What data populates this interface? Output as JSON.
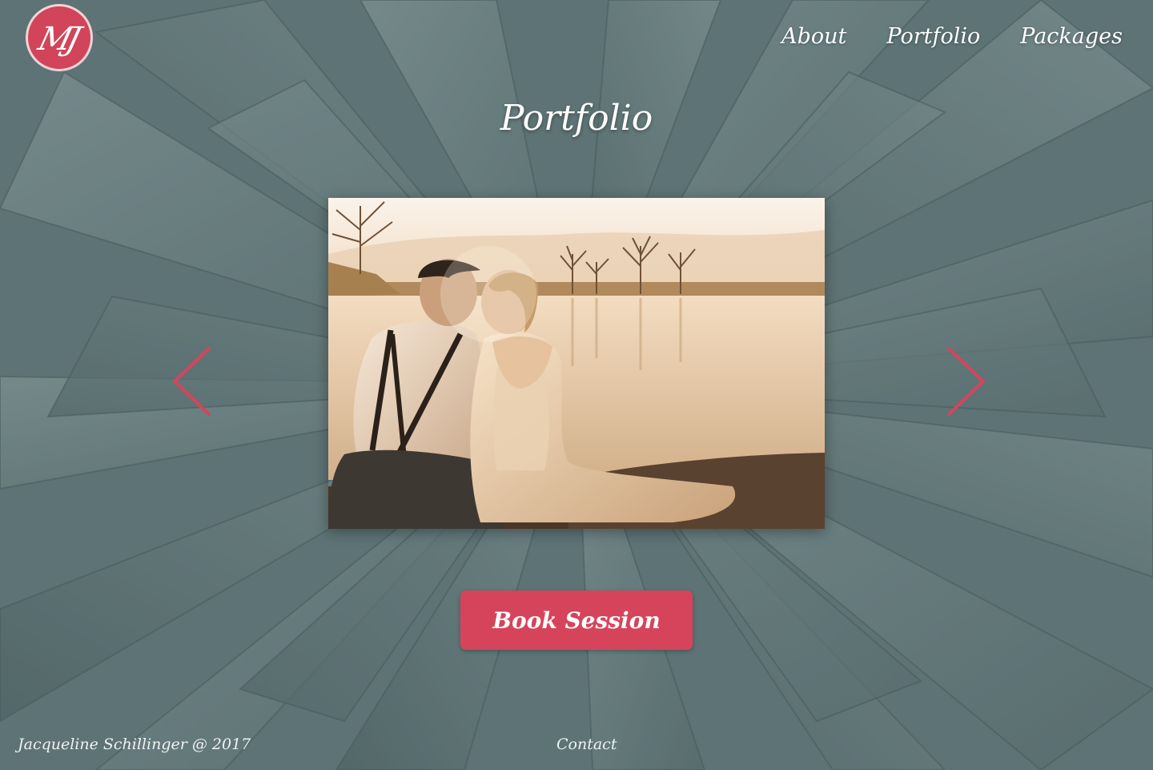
{
  "brand": {
    "logo_text": "MJ",
    "logo_color": "#d14459"
  },
  "nav": {
    "items": [
      {
        "label": "About"
      },
      {
        "label": "Portfolio"
      },
      {
        "label": "Packages"
      }
    ]
  },
  "main": {
    "title": "Portfolio",
    "carousel": {
      "prev_icon": "chevron-left-icon",
      "next_icon": "chevron-right-icon",
      "arrow_color": "#d6445c"
    },
    "book_label": "Book Session",
    "book_color": "#d6445c"
  },
  "footer": {
    "copyright": "Jacqueline Schillinger @ 2017",
    "contact_label": "Contact"
  }
}
